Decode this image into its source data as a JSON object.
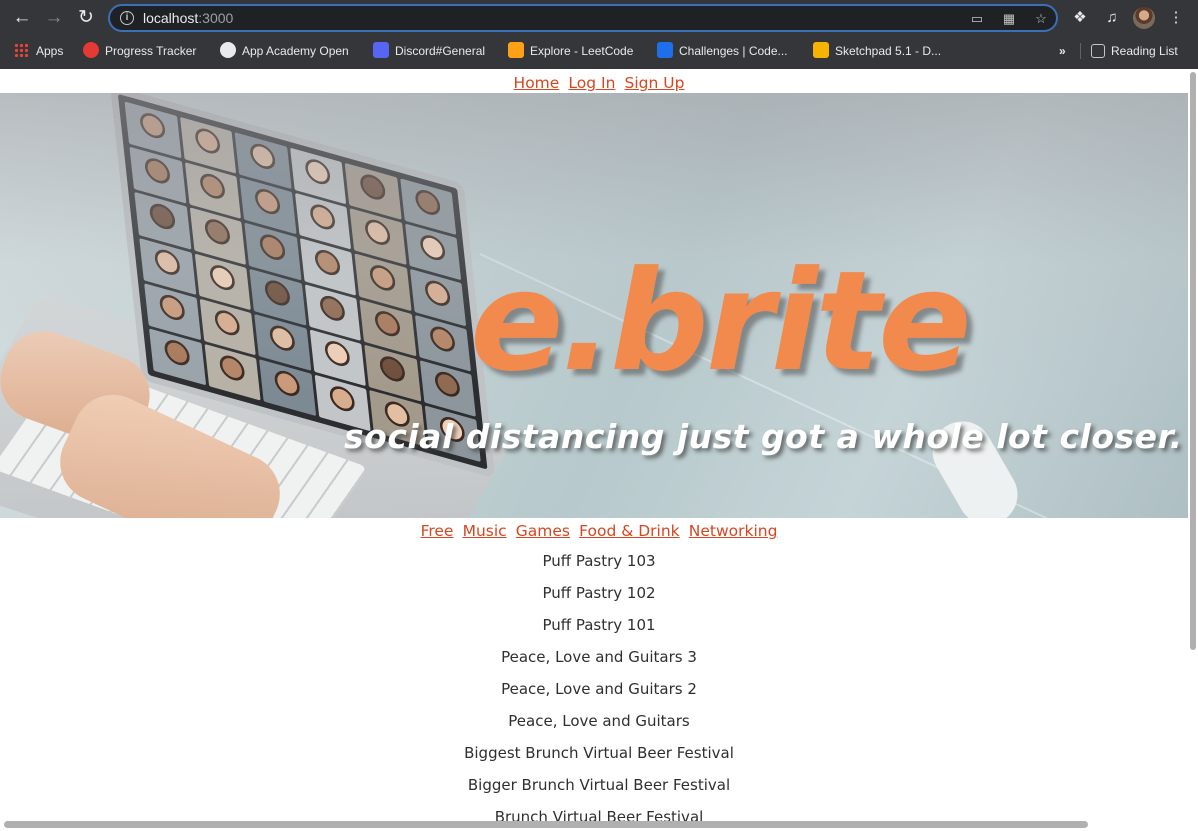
{
  "browser": {
    "url_host": "localhost",
    "url_port": ":3000",
    "bookmarks": [
      {
        "label": "Apps",
        "icon": "apps-grid-icon",
        "color": "#4285f4"
      },
      {
        "label": "Progress Tracker",
        "icon": "progress-tracker-icon",
        "color": "#ea4335"
      },
      {
        "label": "App Academy Open",
        "icon": "globe-icon",
        "color": "#e8eaed"
      },
      {
        "label": "Discord#General",
        "icon": "discord-icon",
        "color": "#5865f2"
      },
      {
        "label": "Explore - LeetCode",
        "icon": "leetcode-icon",
        "color": "#ffa116"
      },
      {
        "label": "Challenges | Code...",
        "icon": "codewars-icon",
        "color": "#1f6feb"
      },
      {
        "label": "Sketchpad 5.1 - D...",
        "icon": "sketchpad-icon",
        "color": "#f4b400"
      }
    ],
    "overflow_label": "»",
    "reading_list": "Reading List"
  },
  "site_nav": {
    "home": "Home",
    "login": "Log In",
    "signup": "Sign Up"
  },
  "hero": {
    "logo": "e.brite",
    "tagline": "social distancing just got a whole lot closer."
  },
  "categories": [
    "Free",
    "Music",
    "Games",
    "Food & Drink",
    "Networking"
  ],
  "events": [
    "Puff Pastry 103",
    "Puff Pastry 102",
    "Puff Pastry 101",
    "Peace, Love and Guitars 3",
    "Peace, Love and Guitars 2",
    "Peace, Love and Guitars",
    "Biggest Brunch Virtual Beer Festival",
    "Bigger Brunch Virtual Beer Festival",
    "Brunch Virtual Beer Festival"
  ],
  "colors": {
    "accent": "#d9451f",
    "logo": "#f28a4e"
  }
}
